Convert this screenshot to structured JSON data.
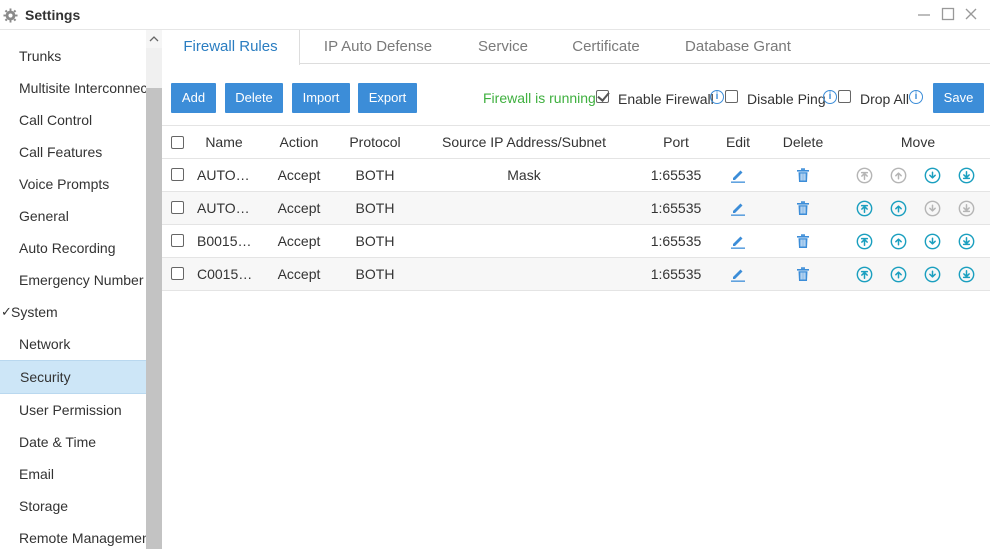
{
  "window": {
    "title": "Settings"
  },
  "sidebar": {
    "items": [
      {
        "label": "Trunks"
      },
      {
        "label": "Multisite Interconnect"
      },
      {
        "label": "Call Control"
      },
      {
        "label": "Call Features"
      },
      {
        "label": "Voice Prompts"
      },
      {
        "label": "General"
      },
      {
        "label": "Auto Recording"
      },
      {
        "label": "Emergency Number"
      },
      {
        "label": "System",
        "group": true
      },
      {
        "label": "Network"
      },
      {
        "label": "Security",
        "active": true
      },
      {
        "label": "User Permission"
      },
      {
        "label": "Date & Time"
      },
      {
        "label": "Email"
      },
      {
        "label": "Storage"
      },
      {
        "label": "Remote Management"
      }
    ]
  },
  "tabs": [
    {
      "label": "Firewall Rules",
      "active": true
    },
    {
      "label": "IP Auto Defense"
    },
    {
      "label": "Service"
    },
    {
      "label": "Certificate"
    },
    {
      "label": "Database Grant"
    }
  ],
  "toolbar": {
    "add_label": "Add",
    "delete_label": "Delete",
    "import_label": "Import",
    "export_label": "Export",
    "status": "Firewall is running",
    "enable_firewall_label": "Enable Firewall",
    "enable_firewall_checked": true,
    "disable_ping_label": "Disable Ping",
    "disable_ping_checked": false,
    "drop_all_label": "Drop All",
    "drop_all_checked": false,
    "save_label": "Save"
  },
  "table": {
    "headers": {
      "name": "Name",
      "action": "Action",
      "protocol": "Protocol",
      "source": "Source IP Address/Subnet Mask",
      "port": "Port",
      "edit": "Edit",
      "delete": "Delete",
      "move": "Move"
    },
    "rows": [
      {
        "name": "AUTO…",
        "action": "Accept",
        "protocol": "BOTH",
        "source": "",
        "port": "1:65535",
        "move_enabled": [
          false,
          false,
          true,
          true
        ]
      },
      {
        "name": "AUTO…",
        "action": "Accept",
        "protocol": "BOTH",
        "source": "",
        "port": "1:65535",
        "move_enabled": [
          true,
          true,
          false,
          false
        ]
      },
      {
        "name": "B0015…",
        "action": "Accept",
        "protocol": "BOTH",
        "source": "",
        "port": "1:65535",
        "move_enabled": [
          true,
          true,
          true,
          true
        ]
      },
      {
        "name": "C0015…",
        "action": "Accept",
        "protocol": "BOTH",
        "source": "",
        "port": "1:65535",
        "move_enabled": [
          true,
          true,
          true,
          true
        ]
      }
    ]
  },
  "colors": {
    "accent": "#3c8dd8",
    "tab_active": "#2a7dc1",
    "status_green": "#3fb03f",
    "move_enabled": "#1a9fbf",
    "move_disabled": "#b5b5b5",
    "sidebar_active": "#cde6f7"
  }
}
